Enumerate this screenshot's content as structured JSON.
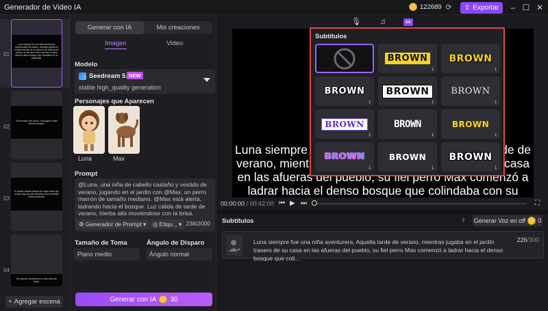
{
  "app": {
    "title": "Generador de Video IA",
    "credits": "122689",
    "export_label": "Exportar"
  },
  "scenes": {
    "items": [
      {
        "num": "01",
        "caption": "Luna siempre fue una niña aventurera. Aquella tarde de verano, mientras jugaba en el jardín trasero de su casa en las afueras del pueblo, su fiel perro Max comenzó a ladrar hacia el denso bosque que colindaba con su propiedad."
      },
      {
        "num": "02",
        "caption": "Sin pensarlo dos veces, Luna siguió a Max hacia el bosque."
      },
      {
        "num": "03",
        "caption": "El camino estaba cubierto de hojas secas que crujían bajo sus pies mientras el sol se filtraba entre los árboles."
      },
      {
        "num": "04",
        "caption": "De repente, encontraron un claro lleno de flores."
      }
    ],
    "add_label": "Agregar escena"
  },
  "panel": {
    "tab_generate": "Generar con IA",
    "tab_creations": "Mis creaciones",
    "subtab_image": "Imagen",
    "subtab_video": "Video",
    "model_label": "Modelo",
    "model_name": "Seedream 5.0",
    "model_badge": "NEW",
    "model_desc": "stable high_quality generation",
    "characters_label": "Personajes que Aparecen",
    "characters": [
      "Luna",
      "Max"
    ],
    "prompt_label": "Prompt",
    "prompt_text": "@Luna, una niña de cabello castaño y vestido de verano, jugando en el jardín con @Max, un perro marrón de tamaño mediano. @Max está alerta, ladrando hacia el bosque. Luz cálida de tarde de verano, hierba alta moviéndose con la brisa.",
    "prompt_generator": "Generador de Prompt",
    "tags_label": "Etiqu...",
    "prompt_count": "238/2000",
    "shot_size_label": "Tamaño de Toma",
    "shot_size_value": "Plano medio",
    "angle_label": "Ángulo de Disparo",
    "angle_value": "Ángulo normal",
    "generate_label": "Generar con IA",
    "generate_cost": "30"
  },
  "preview": {
    "caption": "Luna siempre fue una niña aventurera. Aquella tarde de verano, mientras jugaba en el jardín trasero de su casa en las afueras del pueblo, su fiel perro Max comenzó a ladrar hacia el denso bosque que colindaba con su propiedad",
    "time_current": "00:00:00",
    "time_total": "/ 00:42:00"
  },
  "subtitles": {
    "title": "Subtítulos",
    "voice_label": "Generar Voz en off",
    "voice_cost": "0",
    "text": "Luna siempre fue una niña aventurera. Aquella tarde de verano, mientras jugaba en el jardín trasero de su casa en las afueras del pueblo, su fiel perro Max comenzó a ladrar hacia el denso bosque que coli...",
    "count": "226",
    "count_max": "/300"
  },
  "popup": {
    "title": "Subtítulos",
    "styles": [
      {
        "id": "none",
        "word": ""
      },
      {
        "id": "yellow-box",
        "word": "BROWN"
      },
      {
        "id": "yellow-outline",
        "word": "BROWN"
      },
      {
        "id": "white-black-outline",
        "word": "BROWN"
      },
      {
        "id": "white-box-outline",
        "word": "BROWN"
      },
      {
        "id": "serif-plain",
        "word": "BROWN"
      },
      {
        "id": "purple-box",
        "word": "BROWN"
      },
      {
        "id": "condensed",
        "word": "BROWN"
      },
      {
        "id": "yellow-plain",
        "word": "BROWN"
      },
      {
        "id": "gradient",
        "word": "BROWN"
      },
      {
        "id": "white-shadow",
        "word": "BROWN"
      },
      {
        "id": "white-bold-outline",
        "word": "BROWN"
      }
    ]
  },
  "colors": {
    "accent": "#8a48f5",
    "highlight_border": "#e0453a",
    "yellow": "#f7d21e"
  }
}
